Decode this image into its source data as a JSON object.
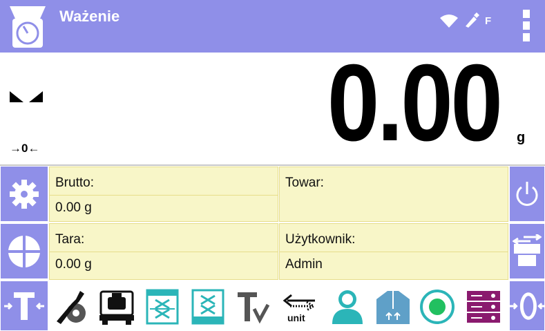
{
  "header": {
    "title": "Ważenie",
    "flag": "F",
    "icons": [
      "scale-icon",
      "wifi-icon",
      "usb-icon",
      "kebab-menu-icon"
    ]
  },
  "display": {
    "reading": "0.00",
    "unit": "g",
    "zero_indicator": "→0←",
    "stability_icon": "stability-icon"
  },
  "info": {
    "brutto_label": "Brutto:",
    "brutto_value": "0.00 g",
    "towar_label": "Towar:",
    "towar_value": "",
    "tara_label": "Tara:",
    "tara_value": "0.00 g",
    "user_label": "Użytkownik:",
    "user_value": "Admin"
  },
  "side_left": [
    "settings-gear-icon",
    "functions-globe-icon",
    "tare-icon"
  ],
  "side_right": [
    "power-icon",
    "print-icon",
    "zero-icon"
  ],
  "toolbar": [
    "adjustment-icon",
    "calibration-weight-icon",
    "tare-database-icon",
    "tare-set-icon",
    "tare-value-icon",
    "unit-change-icon",
    "user-icon",
    "product-icon",
    "status-icon",
    "database-icon"
  ],
  "colors": {
    "accent": "#8f8fe8",
    "cell_bg": "#f8f6c8",
    "teal": "#2bb5b8",
    "purple": "#8a1a6e",
    "green": "#22c060"
  }
}
